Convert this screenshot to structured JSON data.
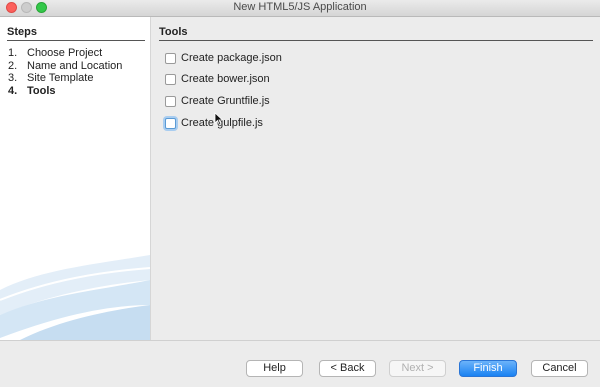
{
  "window": {
    "title": "New HTML5/JS Application"
  },
  "steps": {
    "header": "Steps",
    "items": [
      {
        "num": "1.",
        "label": "Choose Project"
      },
      {
        "num": "2.",
        "label": "Name and Location"
      },
      {
        "num": "3.",
        "label": "Site Template"
      },
      {
        "num": "4.",
        "label": "Tools",
        "active": true
      }
    ]
  },
  "tools": {
    "header": "Tools",
    "options": [
      {
        "label": "Create package.json",
        "checked": false
      },
      {
        "label": "Create bower.json",
        "checked": false
      },
      {
        "label": "Create Gruntfile.js",
        "checked": false
      },
      {
        "label": "Create gulpfile.js",
        "checked": false,
        "focused": true
      }
    ]
  },
  "buttons": {
    "help": "Help",
    "back": "< Back",
    "next": "Next >",
    "finish": "Finish",
    "cancel": "Cancel"
  },
  "colors": {
    "accent": "#1a82f2",
    "focus_ring": "#a9cdf0"
  }
}
